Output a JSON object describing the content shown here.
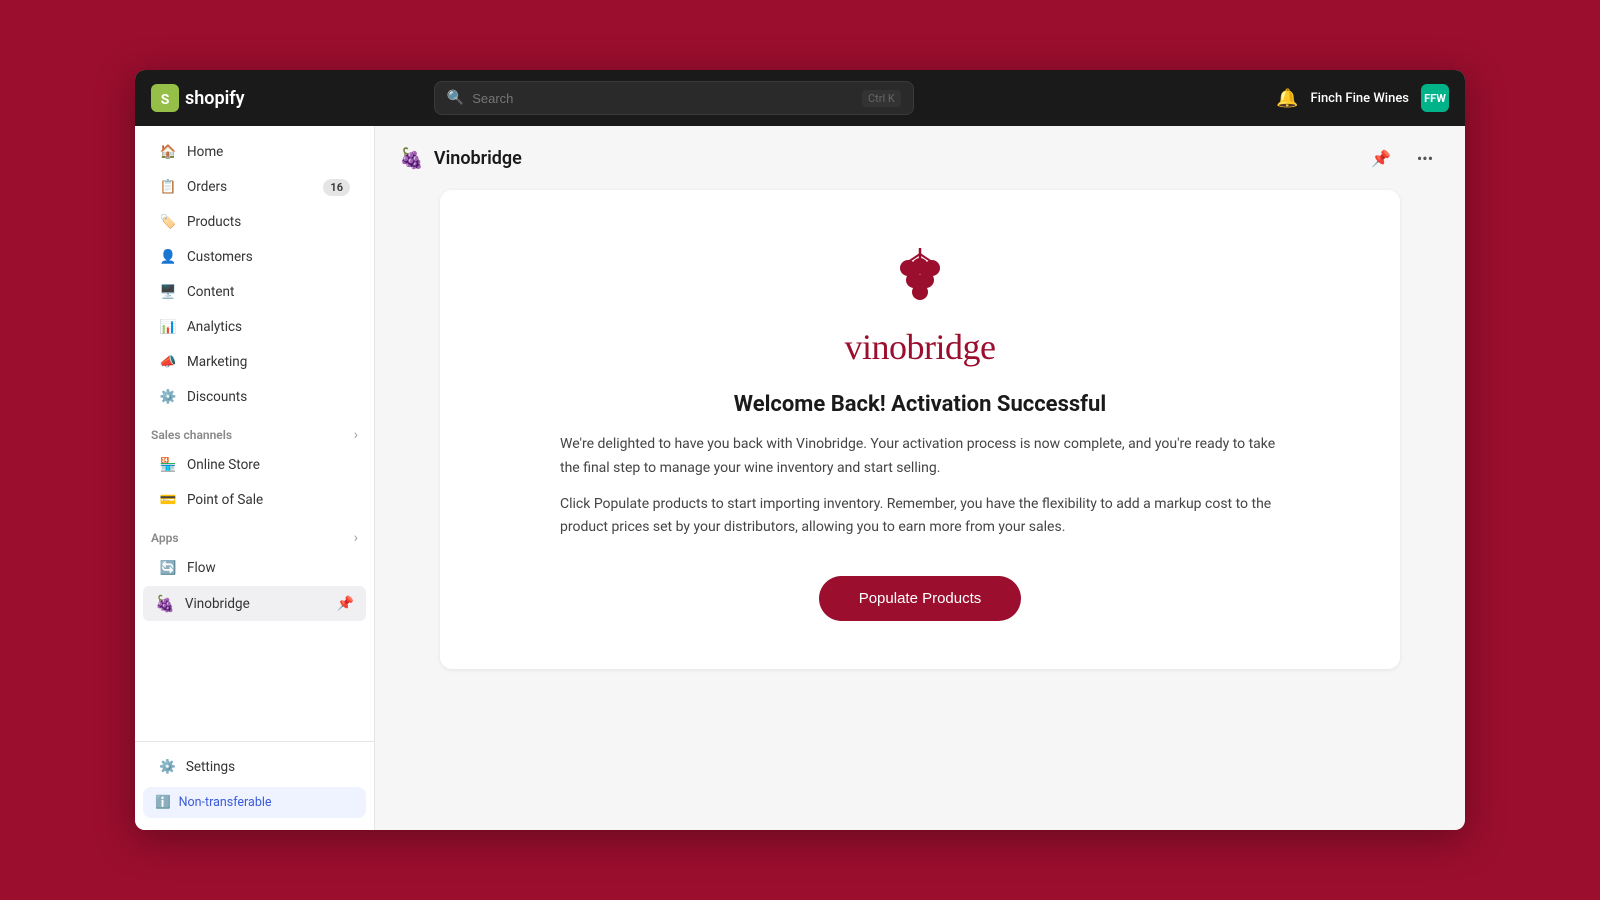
{
  "topNav": {
    "logoText": "shopify",
    "searchPlaceholder": "Search",
    "searchShortcut": "Ctrl K",
    "storeName": "Finch Fine Wines",
    "storeAvatarText": "FFW"
  },
  "sidebar": {
    "navItems": [
      {
        "id": "home",
        "label": "Home",
        "icon": "home"
      },
      {
        "id": "orders",
        "label": "Orders",
        "icon": "orders",
        "badge": "16"
      },
      {
        "id": "products",
        "label": "Products",
        "icon": "products"
      },
      {
        "id": "customers",
        "label": "Customers",
        "icon": "customers"
      },
      {
        "id": "content",
        "label": "Content",
        "icon": "content"
      },
      {
        "id": "analytics",
        "label": "Analytics",
        "icon": "analytics"
      },
      {
        "id": "marketing",
        "label": "Marketing",
        "icon": "marketing"
      },
      {
        "id": "discounts",
        "label": "Discounts",
        "icon": "discounts"
      }
    ],
    "salesChannelsLabel": "Sales channels",
    "salesChannels": [
      {
        "id": "online-store",
        "label": "Online Store",
        "icon": "online-store"
      },
      {
        "id": "point-of-sale",
        "label": "Point of Sale",
        "icon": "pos"
      }
    ],
    "appsLabel": "Apps",
    "apps": [
      {
        "id": "flow",
        "label": "Flow",
        "icon": "flow"
      },
      {
        "id": "vinobridge",
        "label": "Vinobridge",
        "icon": "vinobridge"
      }
    ],
    "settingsLabel": "Settings",
    "nonTransferableLabel": "Non-transferable"
  },
  "pageHeader": {
    "title": "Vinobridge",
    "iconLabel": "grape-icon"
  },
  "welcomeCard": {
    "brandName": "vinobridge",
    "title": "Welcome Back! Activation Successful",
    "descriptionLine1": "We're delighted to have you back with Vinobridge. Your activation process is now complete, and you're ready to take the final step to manage your wine inventory and start selling.",
    "descriptionLine2": "Click Populate products to start importing inventory. Remember, you have the flexibility to add a markup cost to the product prices set by your distributors, allowing you to earn more from your sales.",
    "buttonLabel": "Populate Products"
  }
}
